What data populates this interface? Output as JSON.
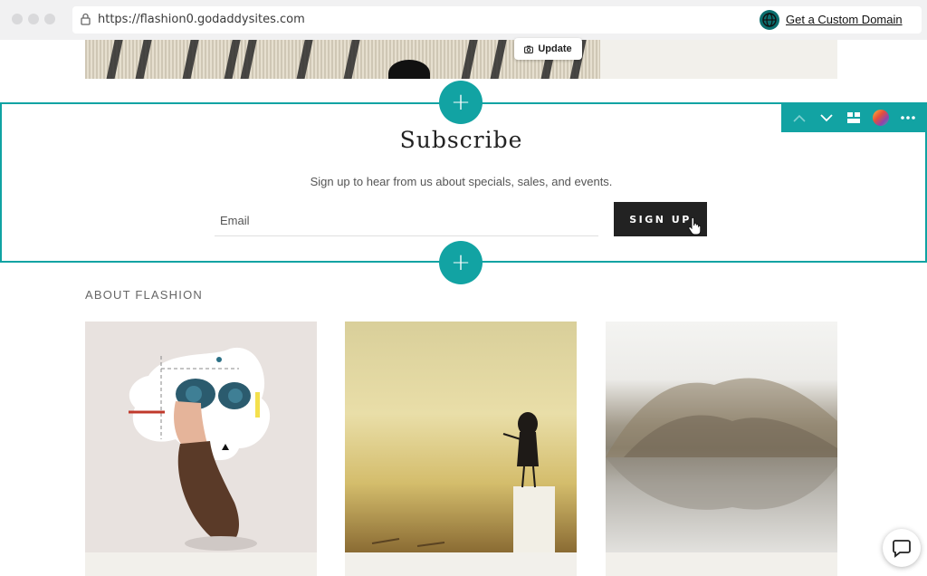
{
  "browser": {
    "url": "https://flashion0.godaddysites.com",
    "custom_domain_label": "Get a Custom Domain"
  },
  "hero": {
    "update_label": "Update"
  },
  "subscribe": {
    "title": "Subscribe",
    "description": "Sign up to hear from us about specials, sales, and events.",
    "email_placeholder": "Email",
    "signup_label": "SIGN UP"
  },
  "add_section_label": "+",
  "toolbar": {
    "icons": [
      "chevron-up-icon",
      "chevron-down-icon",
      "layout-icon",
      "color-palette-icon",
      "more-icon"
    ]
  },
  "about": {
    "heading": "ABOUT FLASHION"
  },
  "colors": {
    "accent": "#12a3a3",
    "dark_button": "#222222",
    "card_bg": "#f2f0eb"
  }
}
